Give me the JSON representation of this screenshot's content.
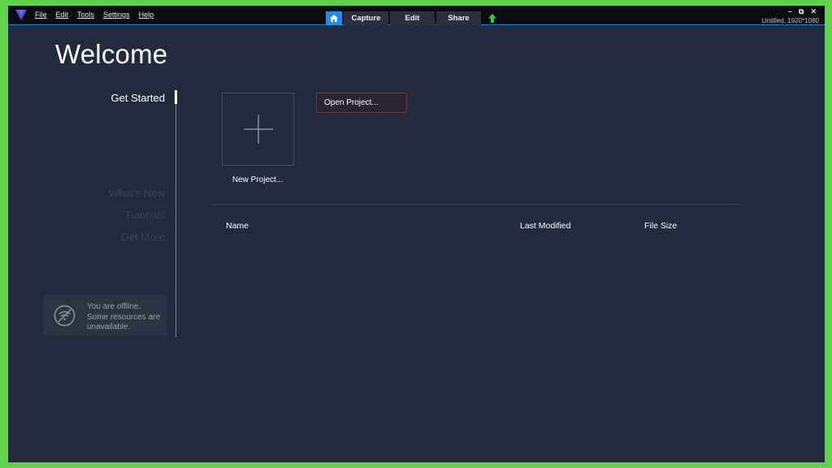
{
  "menu": [
    "File",
    "Edit",
    "Tools",
    "Settings",
    "Help"
  ],
  "tabs": {
    "capture": "Capture",
    "edit": "Edit",
    "share": "Share"
  },
  "window_controls": [
    "–",
    "⧉",
    "✕"
  ],
  "document": "Untitled, 1920*1080",
  "page_title": "Welcome",
  "nav": {
    "active": "Get Started",
    "items": [
      "What's New",
      "Tutorials",
      "Get More"
    ]
  },
  "offline_notice": {
    "line1": "You are offline.",
    "line2": "Some resources are",
    "line3": "unavailable."
  },
  "actions": {
    "new_project": "New Project...",
    "open_project": "Open Project..."
  },
  "table": {
    "headers": [
      "Name",
      "Last Modified",
      "File Size"
    ]
  },
  "colors": {
    "accent": "#1a8ee8",
    "background": "#222b3e",
    "frame": "#5fd14a"
  }
}
